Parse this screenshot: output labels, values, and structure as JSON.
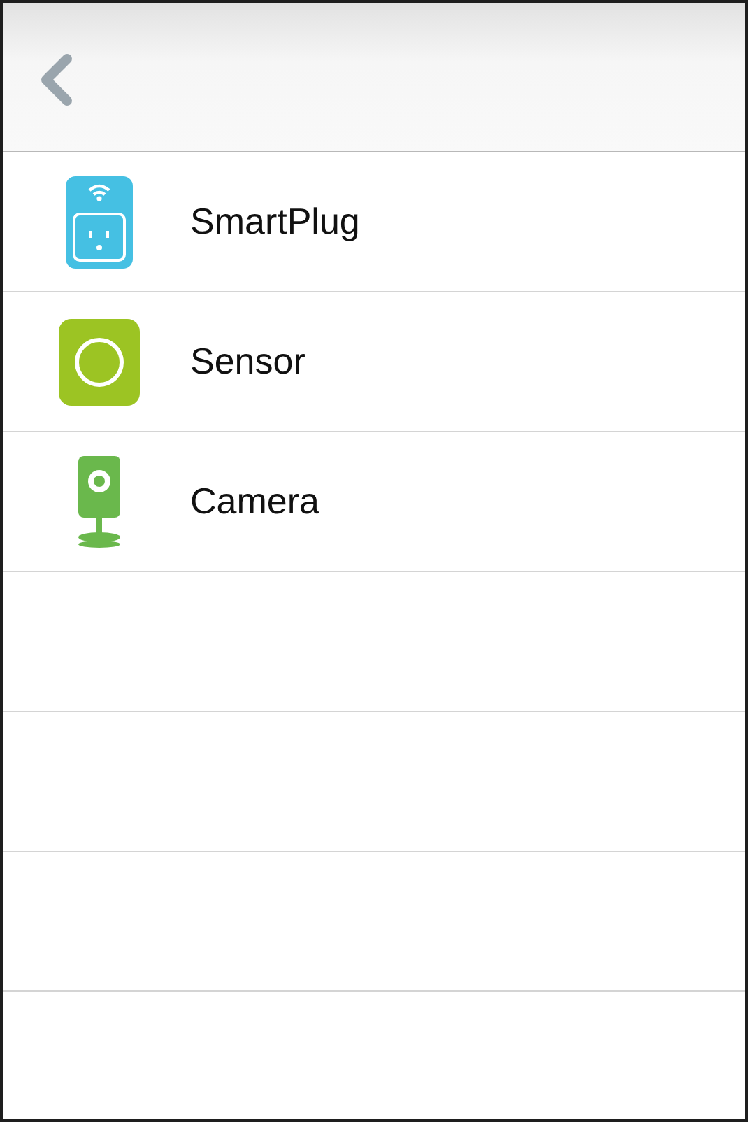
{
  "devices": [
    {
      "kind": "plug",
      "name": "SmartPlug"
    },
    {
      "kind": "sensor",
      "name": "Sensor"
    },
    {
      "kind": "camera",
      "name": "Camera"
    }
  ]
}
